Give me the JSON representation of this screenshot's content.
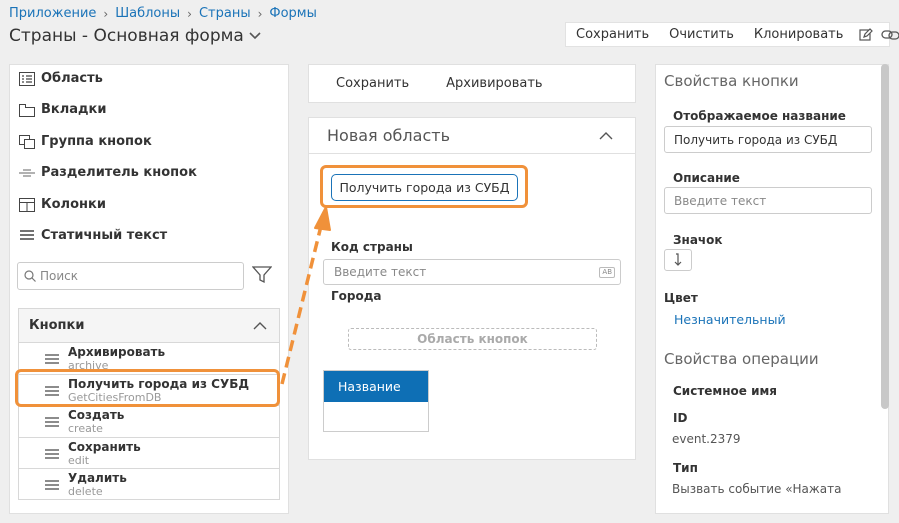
{
  "breadcrumb": [
    "Приложение",
    "Шаблоны",
    "Страны",
    "Формы"
  ],
  "page_title": "Страны - Основная форма",
  "top_toolbar": {
    "save": "Сохранить",
    "clear": "Очистить",
    "clone": "Клонировать"
  },
  "toolbox": {
    "items": [
      {
        "label": "Область",
        "icon": "list-icon"
      },
      {
        "label": "Вкладки",
        "icon": "tabs-icon"
      },
      {
        "label": "Группа кнопок",
        "icon": "button-group-icon"
      },
      {
        "label": "Разделитель кнопок",
        "icon": "separator-icon"
      },
      {
        "label": "Колонки",
        "icon": "columns-icon"
      },
      {
        "label": "Статичный текст",
        "icon": "text-lines-icon"
      }
    ],
    "search_placeholder": "Поиск",
    "buttons_group": {
      "title": "Кнопки",
      "items": [
        {
          "title": "Архивировать",
          "code": "archive"
        },
        {
          "title": "Получить города из СУБД",
          "code": "GetCitiesFromDB"
        },
        {
          "title": "Создать",
          "code": "create"
        },
        {
          "title": "Сохранить",
          "code": "edit"
        },
        {
          "title": "Удалить",
          "code": "delete"
        }
      ]
    }
  },
  "center_toolbar": {
    "save": "Сохранить",
    "archive": "Архивировать"
  },
  "area": {
    "title": "Новая область",
    "button_label": "Получить города из СУБД",
    "country_code_label": "Код страны",
    "country_code_placeholder": "Введите текст",
    "text_badge": "AB",
    "cities_label": "Города",
    "buttons_area_label": "Область кнопок",
    "table_header": "Название"
  },
  "properties": {
    "button_section": "Свойства кнопки",
    "display_name_label": "Отображаемое название",
    "display_name_value": "Получить города из СУБД",
    "description_label": "Описание",
    "description_placeholder": "Введите текст",
    "icon_label": "Значок",
    "color_label": "Цвет",
    "color_value": "Незначительный",
    "operation_section": "Свойства операции",
    "system_name_label": "Системное имя",
    "id_label": "ID",
    "id_value": "event.2379",
    "type_label": "Тип",
    "type_value": "Вызвать событие «Нажата"
  },
  "colors": {
    "accent": "#1a73b8",
    "highlight": "#f0913a",
    "table_header": "#0e6fb5"
  }
}
